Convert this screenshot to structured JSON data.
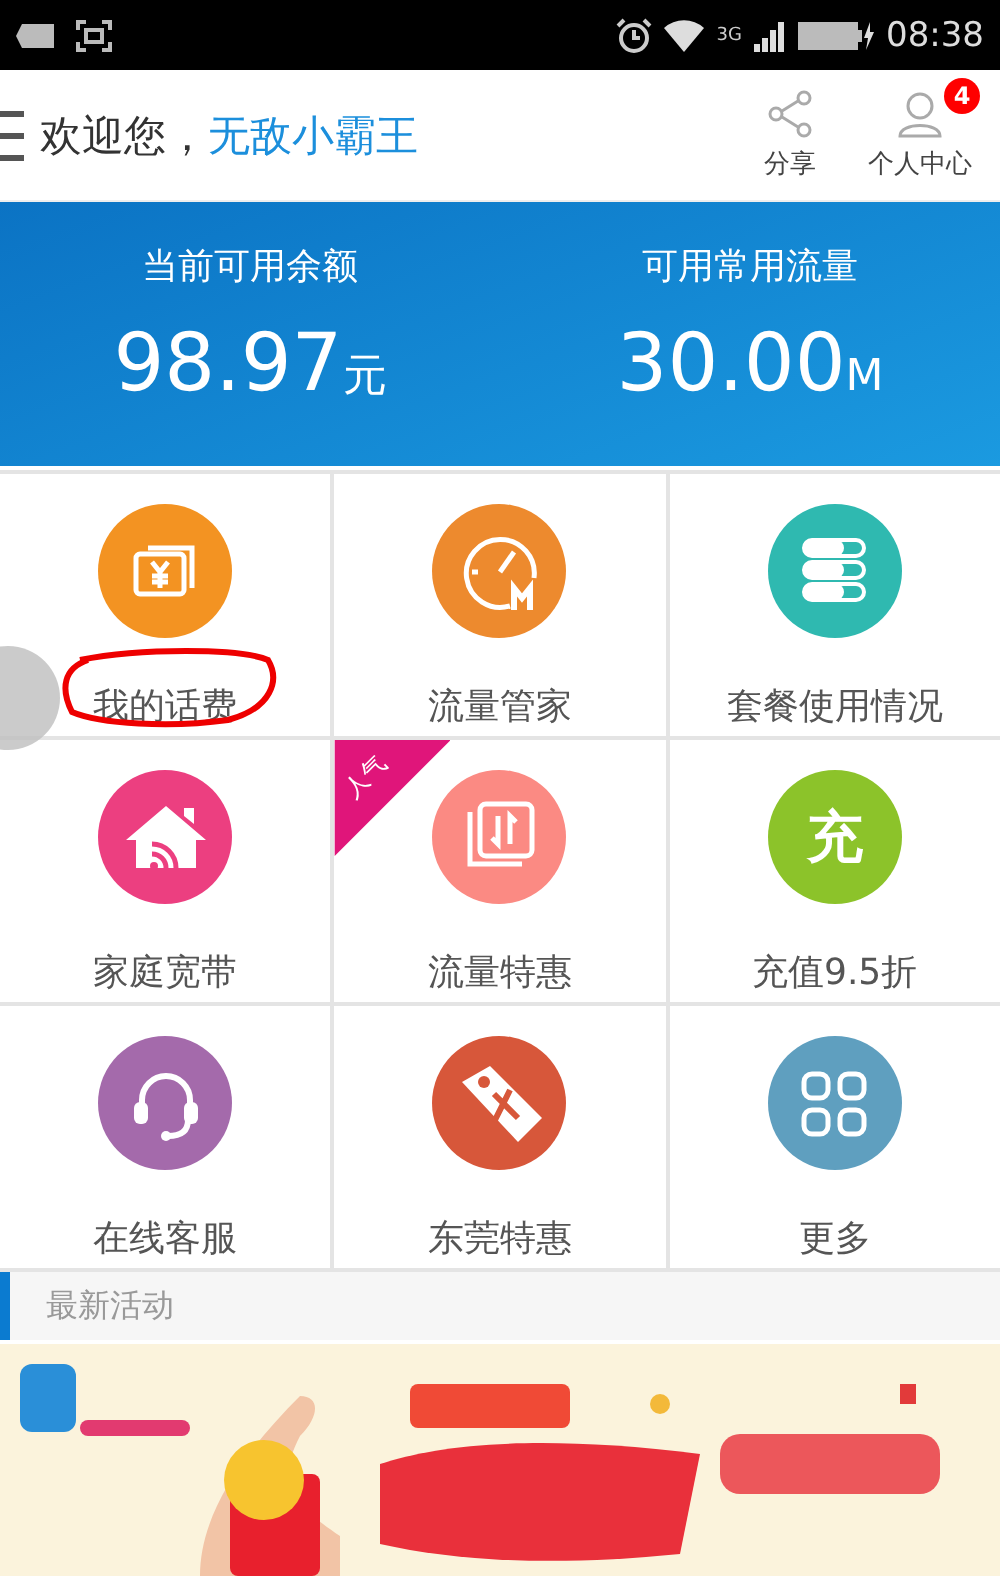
{
  "status_bar": {
    "network": "3G",
    "time": "08:38"
  },
  "header": {
    "greeting": "欢迎您，",
    "username": "无敌小霸王",
    "actions": [
      {
        "kind": "share",
        "label": "分享"
      },
      {
        "kind": "user",
        "label": "个人中心",
        "badge": "4"
      }
    ]
  },
  "balance": [
    {
      "label": "当前可用余额",
      "value": "98.97",
      "unit": "元"
    },
    {
      "label": "可用常用流量",
      "value": "30.00",
      "unit": "M"
    }
  ],
  "grid": [
    {
      "kind": "bill",
      "label": "我的话费",
      "color": "#f39322",
      "circled": true
    },
    {
      "kind": "gauge",
      "label": "流量管家",
      "color": "#ed8a2e"
    },
    {
      "kind": "list",
      "label": "套餐使用情况",
      "color": "#2fb9b0"
    },
    {
      "kind": "home",
      "label": "家庭宽带",
      "color": "#ec3f80"
    },
    {
      "kind": "data",
      "label": "流量特惠",
      "color": "#fb8a83",
      "ribbon": "人气"
    },
    {
      "kind": "glyph",
      "label": "充值9.5折",
      "color": "#8cc32a",
      "glyph": "充"
    },
    {
      "kind": "headset",
      "label": "在线客服",
      "color": "#a46aab"
    },
    {
      "kind": "tag",
      "label": "东莞特惠",
      "color": "#d7573a"
    },
    {
      "kind": "apps",
      "label": "更多",
      "color": "#5f9fbf"
    }
  ],
  "section": {
    "title": "最新活动"
  }
}
